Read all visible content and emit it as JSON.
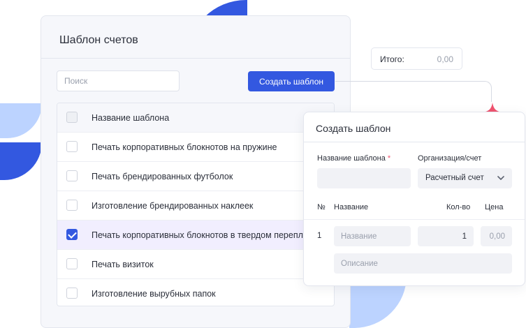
{
  "templates_panel": {
    "title": "Шаблон счетов",
    "search_placeholder": "Поиск",
    "create_button_label": "Создать шаблон",
    "table": {
      "header_label": "Название шаблона",
      "rows": [
        {
          "name": "Печать корпоративных блокнотов на пружине",
          "checked": false
        },
        {
          "name": "Печать брендированных футболок",
          "checked": false
        },
        {
          "name": "Изготовление брендированных наклеек",
          "checked": false
        },
        {
          "name": "Печать корпоративных блокнотов в твердом переплёте",
          "checked": true
        },
        {
          "name": "Печать визиток",
          "checked": false
        },
        {
          "name": "Изготовление вырубных папок",
          "checked": false
        }
      ]
    }
  },
  "total": {
    "label": "Итого:",
    "value": "0,00"
  },
  "create_template_modal": {
    "title": "Создать шаблон",
    "template_name_label": "Название шаблона",
    "required_mark": "*",
    "org_account_label": "Организация/счет",
    "org_account_value": "Расчетный счет",
    "columns": {
      "number": "№",
      "name": "Название",
      "quantity": "Кол-во",
      "price": "Цена"
    },
    "item_row": {
      "number": "1",
      "name_placeholder": "Название",
      "quantity_value": "1",
      "price_placeholder": "0,00",
      "description_placeholder": "Описание"
    }
  },
  "colors": {
    "accent": "#3358e0",
    "accent_light": "#bcd3ff",
    "mint": "#3de0b8",
    "sparkle": "#f0536f",
    "selected_row": "#f1eefe"
  },
  "icons": [
    "checkbox-icon",
    "check-icon",
    "chevron-down-icon",
    "sparkle-icon"
  ]
}
